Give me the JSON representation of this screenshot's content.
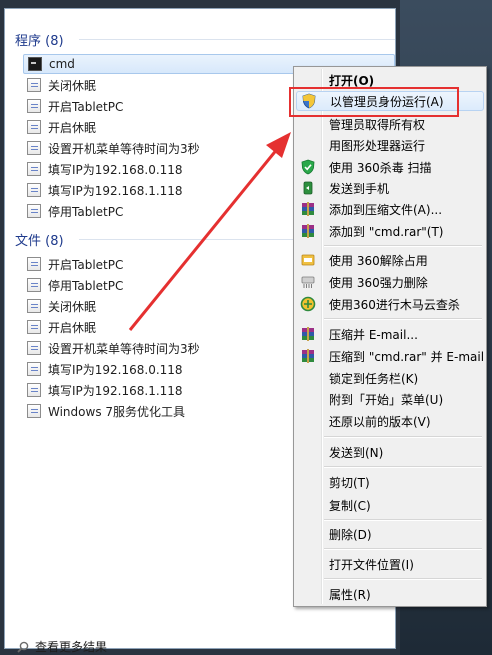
{
  "programs": {
    "header": "程序 (8)",
    "items": [
      {
        "label": "cmd",
        "icon": "cmd-icon"
      },
      {
        "label": "关闭休眠",
        "icon": "file-icon"
      },
      {
        "label": "开启TabletPC",
        "icon": "file-icon"
      },
      {
        "label": "开启休眠",
        "icon": "file-icon"
      },
      {
        "label": "设置开机菜单等待时间为3秒",
        "icon": "file-icon"
      },
      {
        "label": "填写IP为192.168.0.118",
        "icon": "file-icon"
      },
      {
        "label": "填写IP为192.168.1.118",
        "icon": "file-icon"
      },
      {
        "label": "停用TabletPC",
        "icon": "file-icon"
      }
    ]
  },
  "files": {
    "header": "文件 (8)",
    "items": [
      {
        "label": "开启TabletPC"
      },
      {
        "label": "停用TabletPC"
      },
      {
        "label": "关闭休眠"
      },
      {
        "label": "开启休眠"
      },
      {
        "label": "设置开机菜单等待时间为3秒"
      },
      {
        "label": "填写IP为192.168.0.118"
      },
      {
        "label": "填写IP为192.168.1.118"
      },
      {
        "label": "Windows 7服务优化工具"
      }
    ]
  },
  "more_results": "查看更多结果",
  "context_menu": {
    "items": [
      {
        "label": "打开(O)",
        "icon": ""
      },
      {
        "label": "以管理员身份运行(A)",
        "icon": "shield-icon"
      },
      {
        "label": "管理员取得所有权",
        "icon": ""
      },
      {
        "label": "用图形处理器运行",
        "icon": ""
      },
      {
        "label": "使用 360杀毒 扫描",
        "icon": "360-antivirus-icon"
      },
      {
        "label": "发送到手机",
        "icon": "send-to-phone-icon"
      },
      {
        "label": "添加到压缩文件(A)...",
        "icon": "winrar-icon"
      },
      {
        "label": "添加到 \"cmd.rar\"(T)",
        "icon": "winrar-icon"
      },
      {
        "label": "使用 360解除占用",
        "icon": "360-unlock-icon"
      },
      {
        "label": "使用 360强力删除",
        "icon": "360-shred-icon"
      },
      {
        "label": "使用360进行木马云查杀",
        "icon": "360-cloud-scan-icon"
      },
      {
        "label": "压缩并 E-mail...",
        "icon": "winrar-icon"
      },
      {
        "label": "压缩到 \"cmd.rar\" 并 E-mail",
        "icon": "winrar-icon"
      },
      {
        "label": "锁定到任务栏(K)",
        "icon": ""
      },
      {
        "label": "附到「开始」菜单(U)",
        "icon": ""
      },
      {
        "label": "还原以前的版本(V)",
        "icon": ""
      },
      {
        "label": "发送到(N)",
        "icon": ""
      },
      {
        "label": "剪切(T)",
        "icon": ""
      },
      {
        "label": "复制(C)",
        "icon": ""
      },
      {
        "label": "删除(D)",
        "icon": ""
      },
      {
        "label": "打开文件位置(I)",
        "icon": ""
      },
      {
        "label": "属性(R)",
        "icon": ""
      }
    ]
  },
  "colors": {
    "annotation_red": "#e53030",
    "section_header": "#1e3a8c"
  }
}
